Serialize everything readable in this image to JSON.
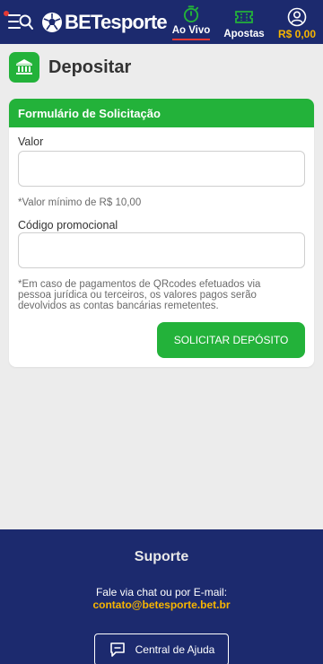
{
  "header": {
    "logo_text": "BETesporte",
    "nav": {
      "ao_vivo": "Ao Vivo",
      "apostas": "Apostas",
      "balance": "R$ 0,00"
    }
  },
  "page": {
    "title": "Depositar"
  },
  "form": {
    "header": "Formulário de Solicitação",
    "valor_label": "Valor",
    "valor_value": "",
    "valor_hint": "*Valor mínimo de R$ 10,00",
    "promo_label": "Código promocional",
    "promo_value": "",
    "disclaimer_lines": [
      "*Em caso de pagamentos de QRcodes efetuados via",
      "pessoa jurídica ou terceiros, os valores pagos serão",
      "devolvidos as contas bancárias remetentes."
    ],
    "submit_label": "SOLICITAR DEPÓSITO"
  },
  "footer": {
    "title": "Suporte",
    "text": "Fale via chat ou por E-mail:",
    "email": "contato@betesporte.bet.br",
    "help_label": "Central de Ajuda"
  },
  "colors": {
    "navy": "#1c2a6e",
    "green": "#23b23a",
    "gold": "#f7b500",
    "red": "#e53935",
    "background": "#ececec"
  },
  "icons": {
    "menu": "menu-search-icon",
    "logo": "soccer-ball-icon",
    "live": "stopwatch-icon",
    "bets": "ticket-icon",
    "account": "user-circle-icon",
    "title": "bank-icon",
    "help": "chat-bubble-icon"
  }
}
